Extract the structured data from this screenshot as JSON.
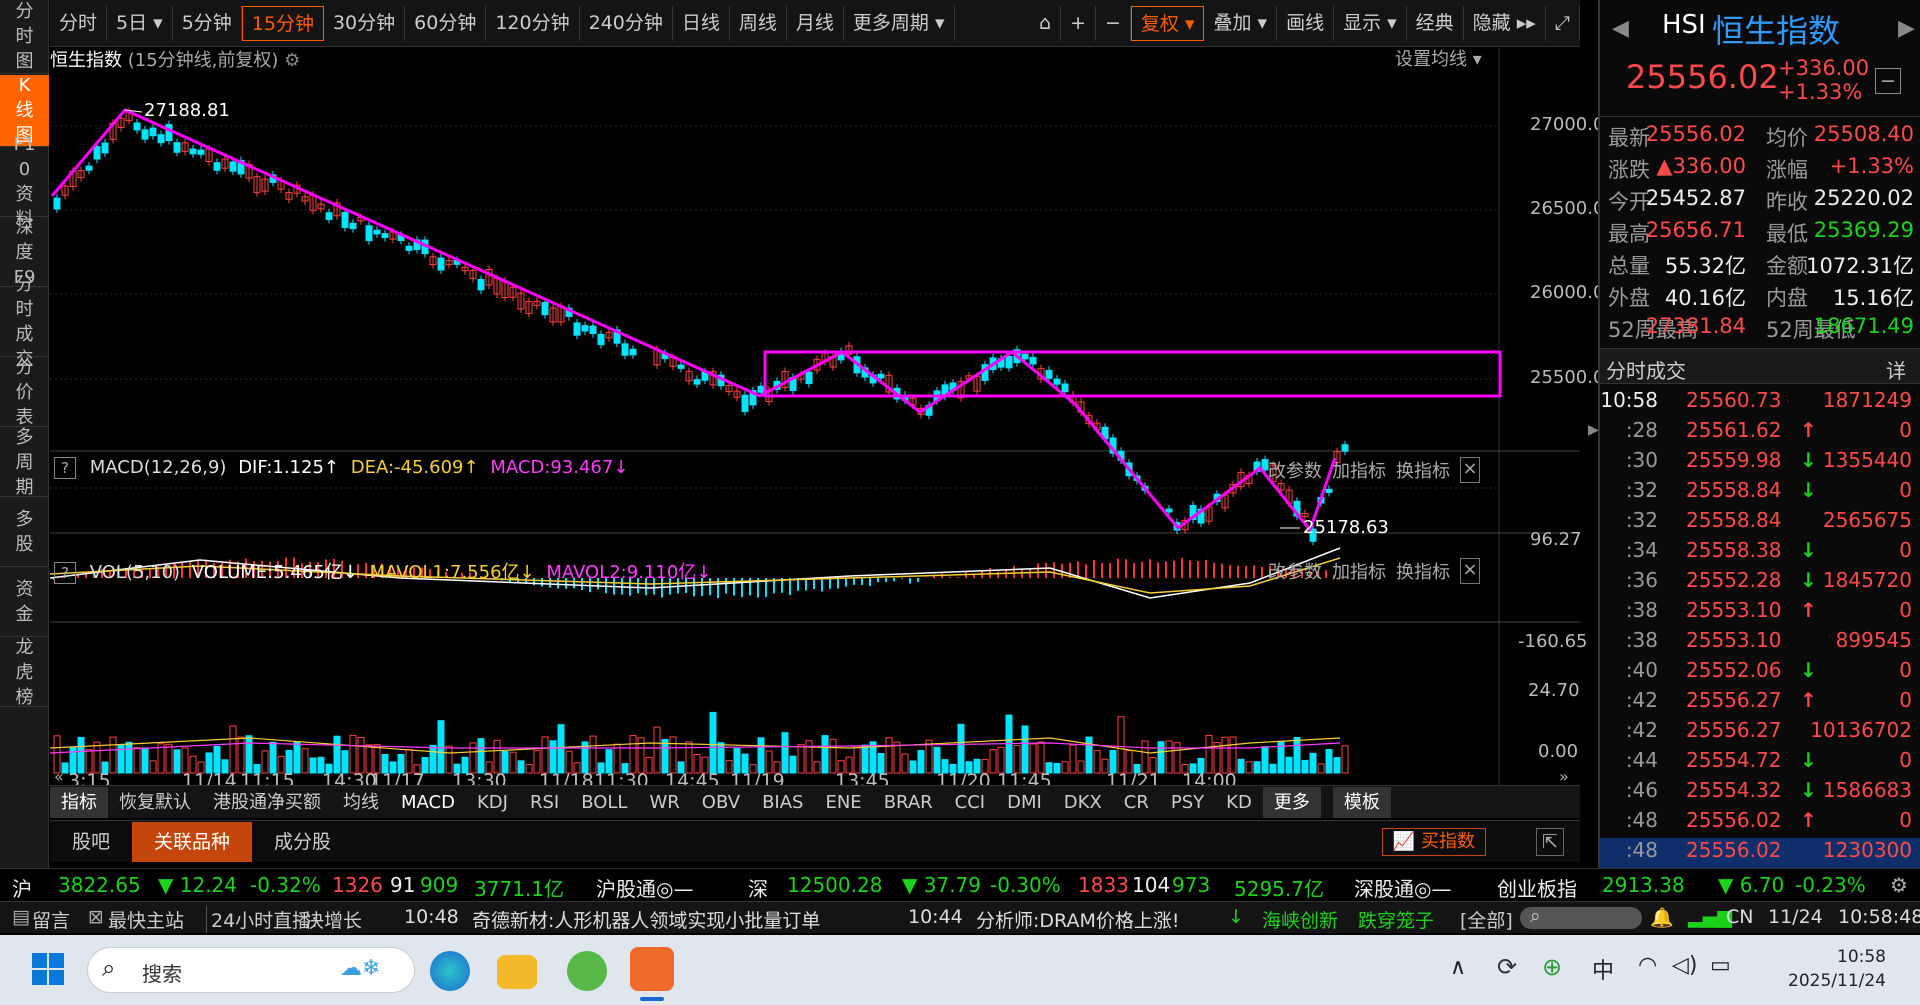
{
  "leftbar": [
    {
      "label": "分时图",
      "active": false
    },
    {
      "label": "K线图",
      "active": true
    },
    {
      "label": "F10资料",
      "active": false
    },
    {
      "label": "深度F9",
      "active": false
    },
    {
      "label": "分时成交",
      "active": false
    },
    {
      "label": "分价表",
      "active": false
    },
    {
      "label": "多周期",
      "active": false
    },
    {
      "label": "多股",
      "active": false
    },
    {
      "label": "资金",
      "active": false
    },
    {
      "label": "龙虎榜",
      "active": false
    }
  ],
  "toolbar": {
    "periods": [
      "分时",
      "5日 ▾",
      "5分钟",
      "15分钟",
      "30分钟",
      "60分钟",
      "120分钟",
      "240分钟",
      "日线",
      "周线",
      "月线",
      "更多周期 ▾"
    ],
    "active_period": "15分钟",
    "right": [
      "复权 ▾",
      "叠加 ▾",
      "画线",
      "显示 ▾",
      "经典",
      "隐藏 ▸▸"
    ]
  },
  "chart": {
    "title": "恒生指数",
    "subtitle": "(15分钟线,前复权)",
    "set_ma": "设置均线 ▾",
    "price_axis": [
      "27000.0",
      "26500.0",
      "26000.0",
      "25500.0"
    ],
    "high_label": "27188.81",
    "low_label": "25178.63",
    "macd": {
      "name": "MACD(12,26,9)",
      "dif": "DIF:1.125↑",
      "dea": "DEA:-45.609↑",
      "macd": "MACD:93.467↓",
      "axis_top": "96.27",
      "axis_bottom": "-160.65"
    },
    "vol": {
      "name": "VOL(5,10)",
      "volume": "VOLUME:5.465亿↓",
      "mavol1": "MAVOL1:7.556亿↓",
      "mavol2": "MAVOL2:9.110亿↓",
      "axis_top": "24.70",
      "axis_bottom": "0.00"
    },
    "panel_actions": [
      "改参数",
      "加指标",
      "换指标"
    ],
    "x_labels": [
      "3:15",
      "11/14",
      "11:15",
      "14:30",
      "11/17",
      "13:30",
      "11/18",
      "11:30",
      "14:45",
      "11/19",
      "13:45",
      "11/20",
      "11:45",
      "11/21",
      "14:00"
    ]
  },
  "indicator_tabs": [
    "指标",
    "恢复默认",
    "港股通净买额",
    "均线",
    "MACD",
    "KDJ",
    "RSI",
    "BOLL",
    "WR",
    "OBV",
    "BIAS",
    "ENE",
    "BRAR",
    "CCI",
    "DMI",
    "DKX",
    "CR",
    "PSY",
    "KD",
    "更多",
    "模板"
  ],
  "sub_tabs": [
    "股吧",
    "关联品种",
    "成分股"
  ],
  "buy_index": "买指数",
  "quote": {
    "code": "HSI",
    "name": "恒生指数",
    "price": "25556.02",
    "change": "+336.00",
    "pct": "+1.33%",
    "rows": [
      [
        "最新",
        "25556.02",
        "均价",
        "25508.40"
      ],
      [
        "涨跌",
        "▲336.00",
        "涨幅",
        "+1.33%"
      ],
      [
        "今开",
        "25452.87",
        "昨收",
        "25220.02"
      ],
      [
        "最高",
        "25656.71",
        "最低",
        "25369.29"
      ],
      [
        "总量",
        "55.32亿",
        "金额",
        "1072.31亿"
      ],
      [
        "外盘",
        "40.16亿",
        "内盘",
        "15.16亿"
      ],
      [
        "52周最高",
        "27381.84",
        "52周最低",
        "18671.49"
      ]
    ],
    "ticks_title": "分时成交",
    "ticks_detail": "详",
    "ticks": [
      [
        "10:58",
        "25560.73",
        "",
        "1871249"
      ],
      [
        ":28",
        "25561.62",
        "up",
        "0"
      ],
      [
        ":30",
        "25559.98",
        "down",
        "1355440"
      ],
      [
        ":32",
        "25558.84",
        "down",
        "0"
      ],
      [
        ":32",
        "25558.84",
        "",
        "2565675"
      ],
      [
        ":34",
        "25558.38",
        "down",
        "0"
      ],
      [
        ":36",
        "25552.28",
        "down",
        "1845720"
      ],
      [
        ":38",
        "25553.10",
        "up",
        "0"
      ],
      [
        ":38",
        "25553.10",
        "",
        "899545"
      ],
      [
        ":40",
        "25552.06",
        "down",
        "0"
      ],
      [
        ":42",
        "25556.27",
        "up",
        "0"
      ],
      [
        ":42",
        "25556.27",
        "",
        "10136702"
      ],
      [
        ":44",
        "25554.72",
        "down",
        "0"
      ],
      [
        ":46",
        "25554.32",
        "down",
        "1586683"
      ],
      [
        ":48",
        "25556.02",
        "up",
        "0"
      ],
      [
        ":48",
        "25556.02",
        "",
        "1230300"
      ]
    ]
  },
  "market": {
    "sh": [
      "沪",
      "3822.65",
      "▼ 12.24",
      "-0.32%",
      "1326",
      "91",
      "909",
      "3771.1亿",
      "沪股通◎—"
    ],
    "sz": [
      "深",
      "12500.28",
      "▼ 37.79",
      "-0.30%",
      "1833",
      "104",
      "973",
      "5295.7亿",
      "深股通◎—"
    ],
    "cy": [
      "创业板指",
      "2913.38",
      "▼ 6.70",
      "-0.23%"
    ]
  },
  "news": {
    "left": [
      "留言",
      "最快主站",
      "24小时直播:",
      "决增长"
    ],
    "items": [
      "10:48",
      "奇德新材:人形机器人领域实现小批量订单",
      "10:44",
      "分析师:DRAM价格上涨!"
    ],
    "stock": [
      "海峡创新",
      "跌穿笼子",
      "[全部]"
    ],
    "right": [
      "CN",
      "11/24",
      "10:58:48"
    ]
  },
  "taskbar": {
    "search": "搜索",
    "time": "10:58",
    "date": "2025/11/24",
    "ime": "中"
  }
}
